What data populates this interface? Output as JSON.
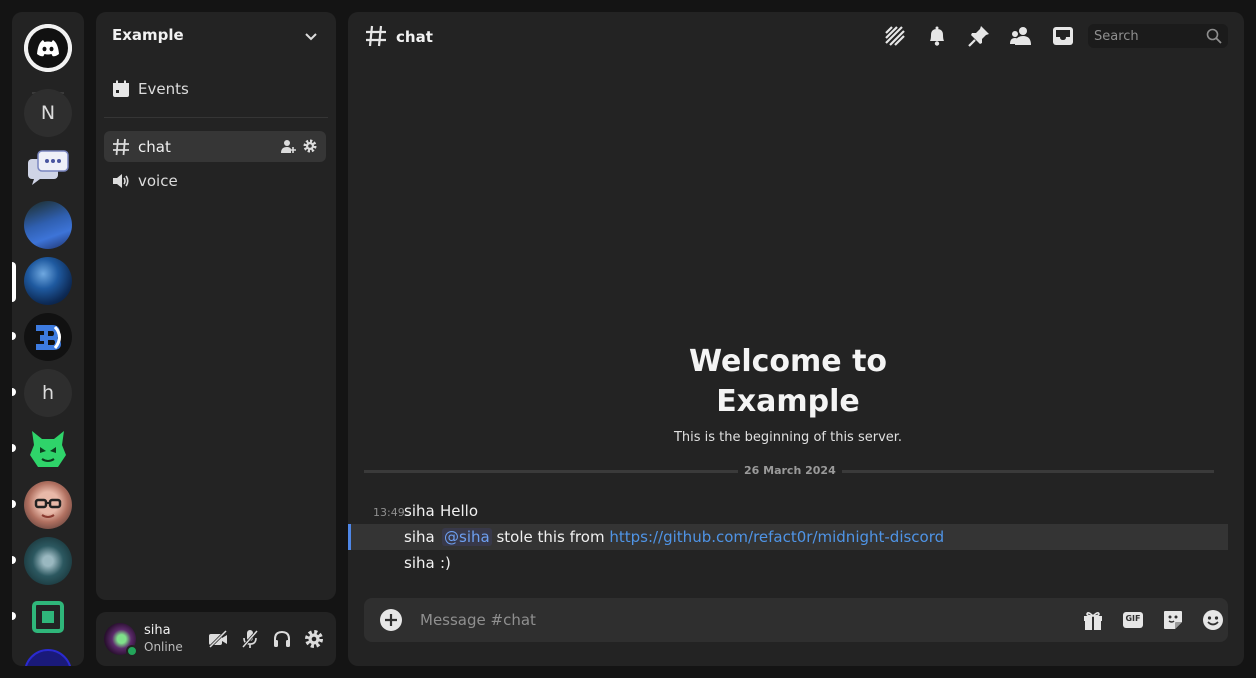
{
  "rail": {
    "servers": [
      {
        "name": "discord-home",
        "label": ""
      },
      {
        "name": "server-n",
        "label": "N"
      },
      {
        "name": "server-h",
        "label": "h"
      }
    ]
  },
  "sidebar": {
    "server_name": "Example",
    "events_label": "Events",
    "channels": [
      {
        "label": "chat",
        "type": "text"
      },
      {
        "label": "voice",
        "type": "voice"
      }
    ]
  },
  "user": {
    "name": "siha",
    "status": "Online"
  },
  "header": {
    "channel": "chat",
    "search_placeholder": "Search"
  },
  "welcome": {
    "title_line1": "Welcome to",
    "title_line2": "Example",
    "subtitle": "This is the beginning of this server."
  },
  "divider_date": "26 March 2024",
  "messages": [
    {
      "time": "13:49",
      "author": "siha",
      "text": "Hello"
    },
    {
      "author": "siha",
      "mention": "@siha",
      "text": "stole this from",
      "link": "https://github.com/refact0r/midnight-discord"
    },
    {
      "author": "siha",
      "text": ":)"
    }
  ],
  "composer": {
    "placeholder": "Message #chat",
    "gif_label": "GIF"
  },
  "colors": {
    "background": "#141414",
    "panel": "#232323",
    "accent_link": "#4f94e6",
    "online": "#23a55a"
  }
}
